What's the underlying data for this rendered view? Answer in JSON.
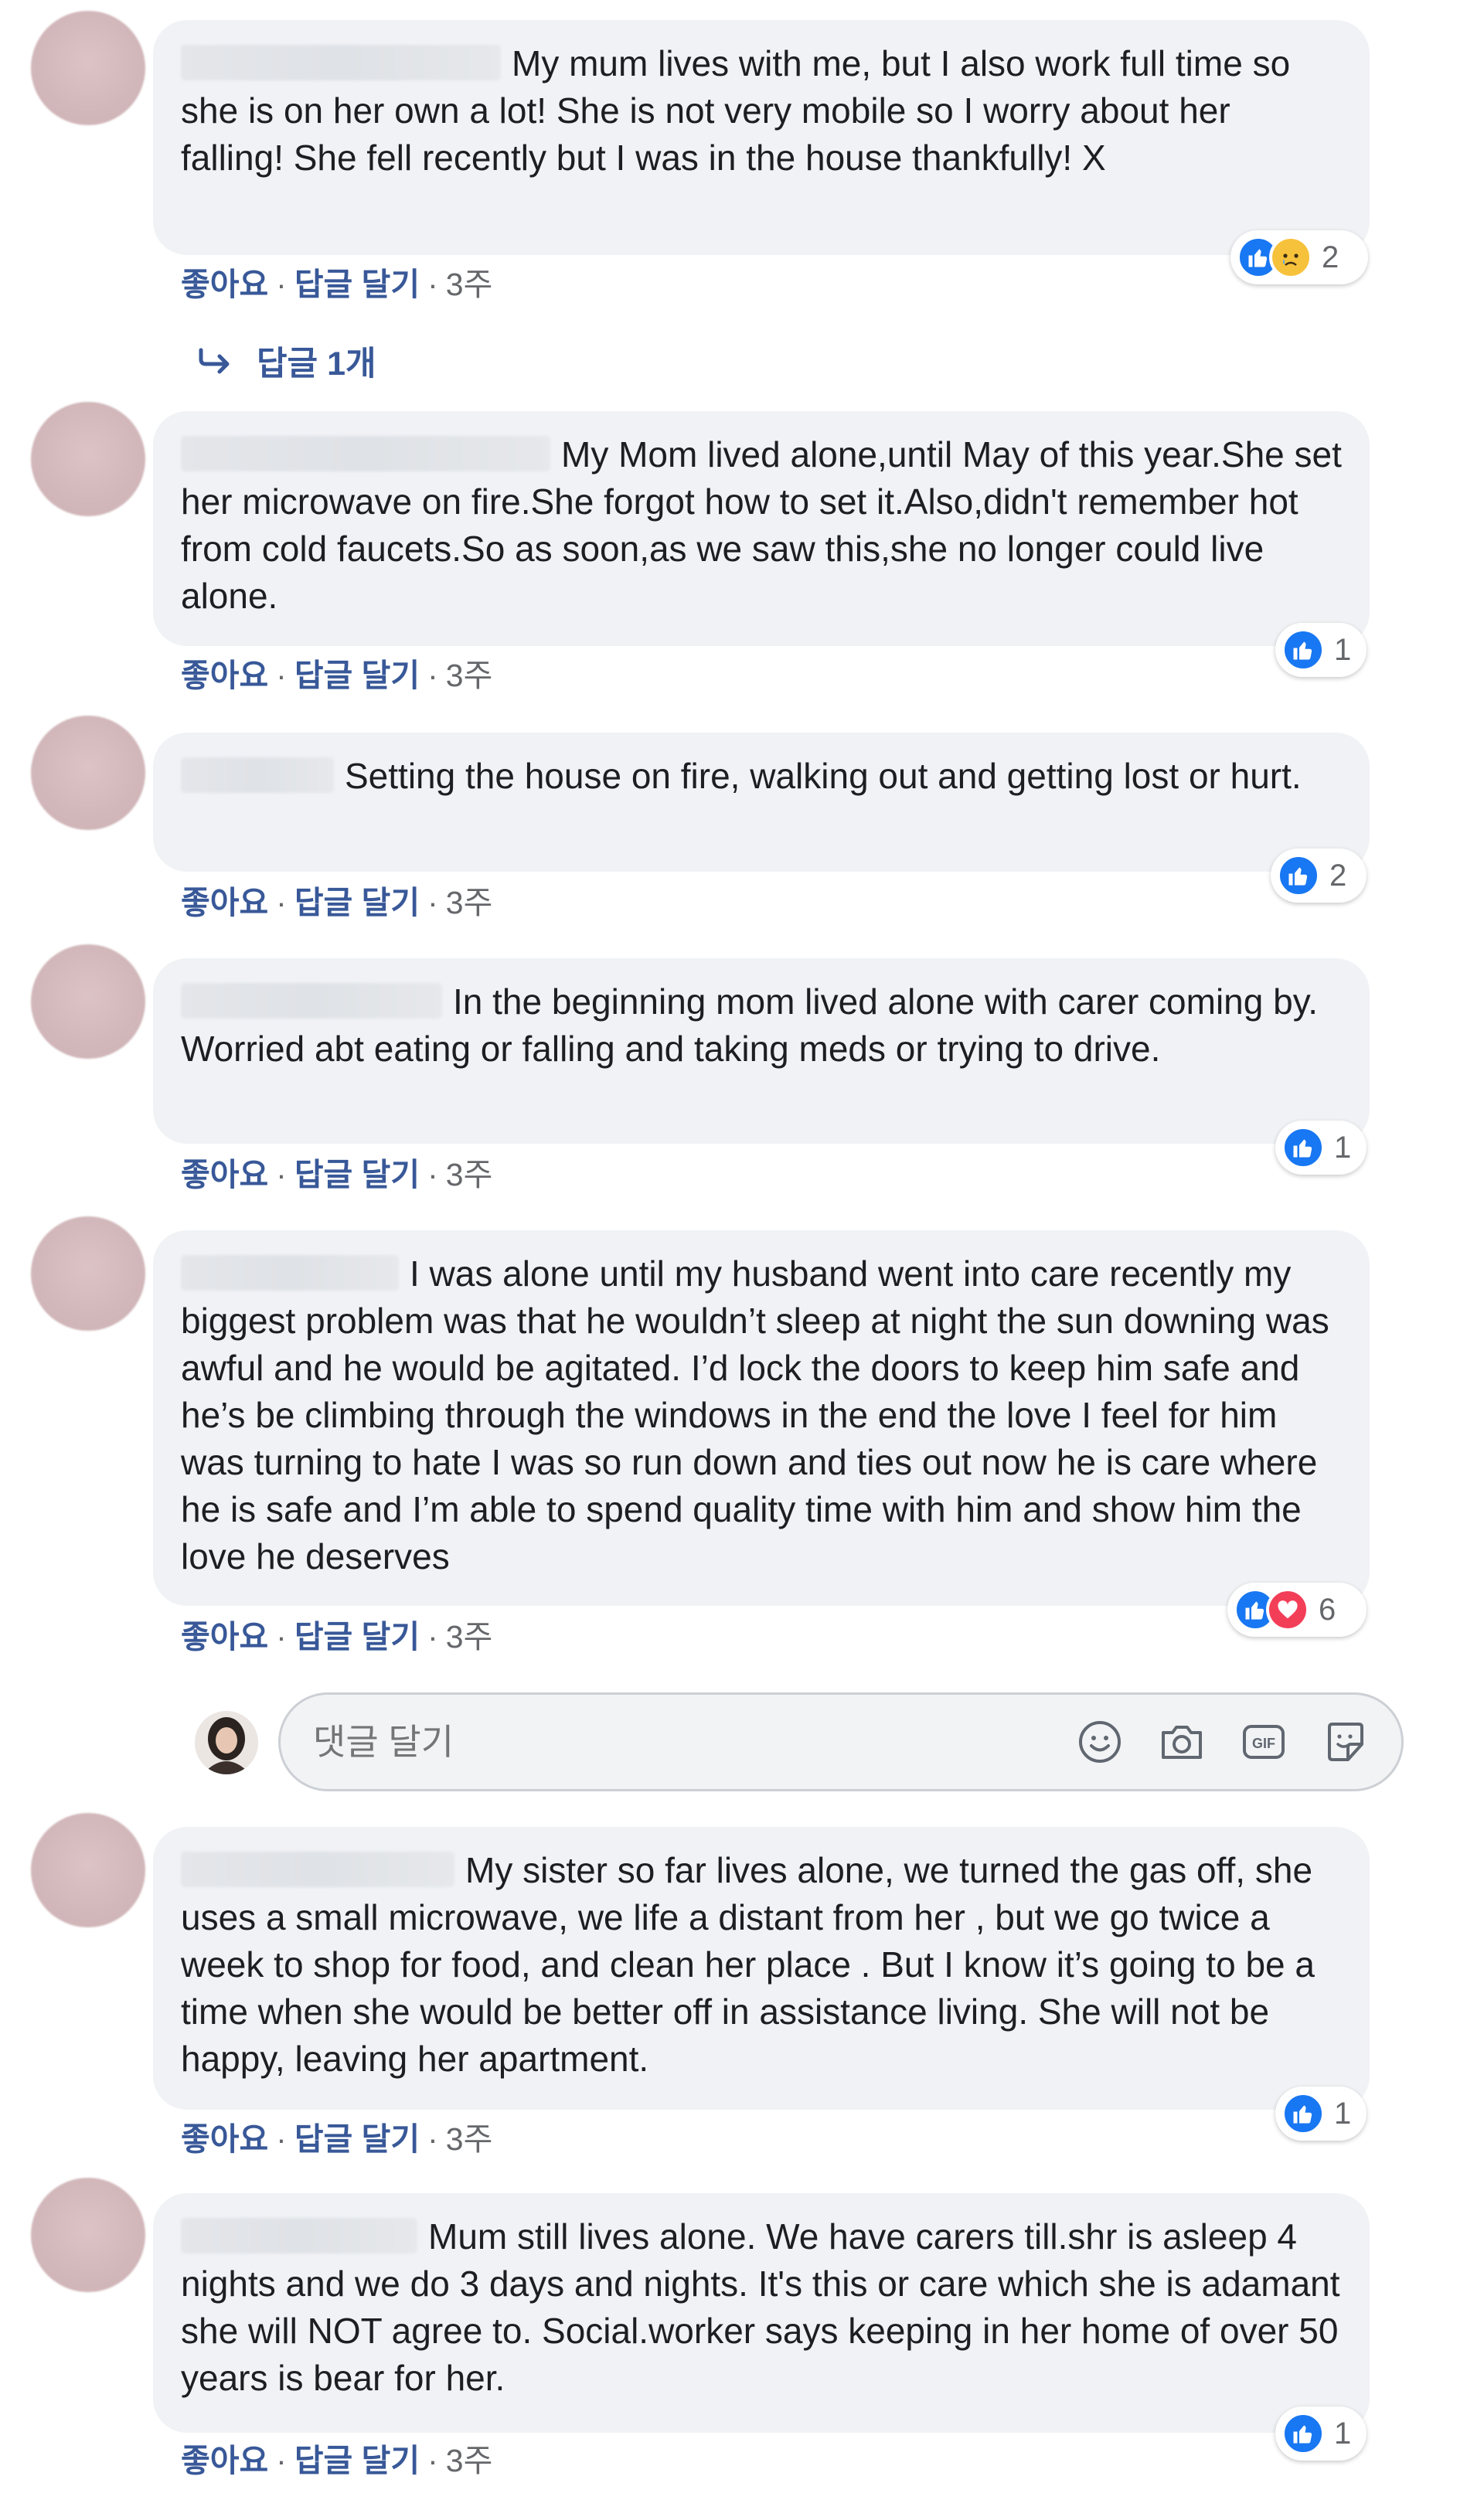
{
  "comments": [
    {
      "text": "My mum lives with me, but I also work full time so she is on her own a lot! She is not very mobile so I worry about her falling! She fell recently but I was in the house thankfully! X",
      "reactions": [
        "like-icon",
        "sad-icon"
      ],
      "count": "2"
    },
    {
      "text": "My Mom lived alone,until May of this year.She set her microwave on fire.She forgot how to set it.Also,didn't remember hot from cold faucets.So as soon,as we saw this,she no longer could live alone.",
      "reactions": [
        "like-icon"
      ],
      "count": "1"
    },
    {
      "text": "Setting the house on fire, walking out and getting lost or hurt.",
      "reactions": [
        "like-icon"
      ],
      "count": "2"
    },
    {
      "text": "In the beginning mom lived alone with carer coming by. Worried abt eating or falling and taking meds or trying to drive.",
      "reactions": [
        "like-icon"
      ],
      "count": "1"
    },
    {
      "text": "I was alone until my husband went into care recently my biggest problem was that he wouldn’t sleep at night the sun downing was awful and he would be agitated. I’d lock the doors to keep him safe and he’s be climbing through the windows in the end the love I feel for him was turning to hate I was so run down and ties out now he is care where he is safe and I’m able to spend quality time with him and show him the love he deserves",
      "reactions": [
        "like-icon",
        "love-icon"
      ],
      "count": "6"
    },
    {
      "text": "My sister so far lives alone, we turned the gas off, she uses a small microwave, we life a distant from her , but we go twice a week to shop for food, and clean her place . But I know it’s going to be a time when she would be better off in assistance living. She will not be happy, leaving her apartment.",
      "reactions": [
        "like-icon"
      ],
      "count": "1"
    },
    {
      "text": "Mum still lives alone. We have carers till.shr is asleep 4 nights and we do 3 days and nights. It's this or care which she is adamant she will NOT agree to. Social.worker says keeping in her home of over 50 years is bear for her.",
      "reactions": [
        "like-icon"
      ],
      "count": "1"
    }
  ],
  "actions": {
    "like": "좋아요",
    "reply": "답글 달기",
    "dot": "·",
    "time": "3주"
  },
  "reply_toggle": "답글 1개",
  "composer": {
    "placeholder": "댓글 달기",
    "tools": [
      "emoji-icon",
      "camera-icon",
      "gif-icon",
      "sticker-icon"
    ]
  },
  "colors": {
    "bubble": "#f0f2f5",
    "link": "#385898",
    "like": "#1877f2",
    "love": "#f33e58",
    "sad": "#f7c23b"
  }
}
